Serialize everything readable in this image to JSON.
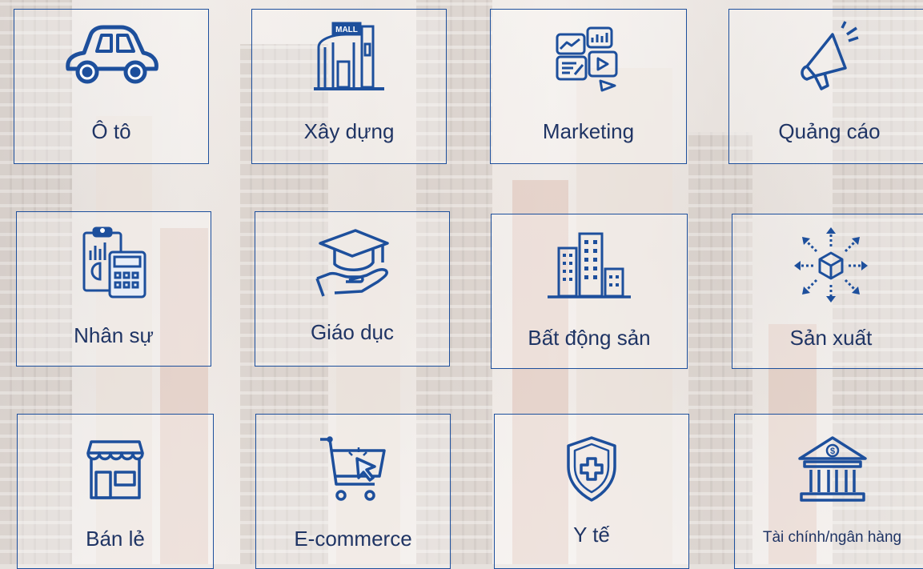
{
  "industries": [
    {
      "label": "Ô tô",
      "icon": "car-icon"
    },
    {
      "label": "Xây dựng",
      "icon": "mall-building-icon",
      "icon_text": "MALL"
    },
    {
      "label": "Marketing",
      "icon": "marketing-media-icon"
    },
    {
      "label": "Quảng cáo",
      "icon": "megaphone-icon"
    },
    {
      "label": "Nhân sự",
      "icon": "clipboard-calculator-icon"
    },
    {
      "label": "Giáo dục",
      "icon": "graduation-cap-hand-icon"
    },
    {
      "label": "Bất động sản",
      "icon": "office-buildings-icon"
    },
    {
      "label": "Sản xuất",
      "icon": "package-distribution-icon"
    },
    {
      "label": "Bán lẻ",
      "icon": "storefront-icon"
    },
    {
      "label": "E-commerce",
      "icon": "shopping-cart-cursor-icon"
    },
    {
      "label": "Y tế",
      "icon": "medical-shield-icon"
    },
    {
      "label": "Tài chính/ngân hàng",
      "icon": "bank-icon",
      "icon_text": "$"
    }
  ],
  "colors": {
    "accent": "#1d4f9c",
    "text": "#1f3464"
  }
}
